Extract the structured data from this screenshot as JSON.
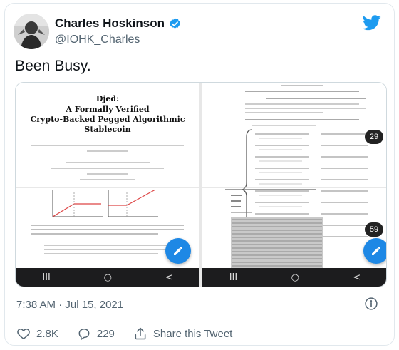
{
  "author": {
    "display_name": "Charles Hoskinson",
    "handle": "@IOHK_Charles"
  },
  "tweet": {
    "text": "Been Busy.",
    "timestamp": "7:38 AM · Jul 15, 2021"
  },
  "media": {
    "left_page": {
      "title_line1": "Djed:",
      "title_line2": "A Formally Verified",
      "title_line3": "Crypto-Backed Pegged Algorithmic",
      "title_line4": "Stablecoin"
    },
    "right_page": {
      "badge_top": "29",
      "badge_bottom": "59"
    },
    "navbar": {
      "recents": "III",
      "home": "○",
      "back": "<"
    }
  },
  "actions": {
    "likes": "2.8K",
    "replies": "229",
    "share_label": "Share this Tweet"
  },
  "colors": {
    "brand": "#1d9bf0",
    "fab": "#1e88e5",
    "muted": "#536471"
  },
  "icons": {
    "verified": "verified-badge-icon",
    "bird": "twitter-bird-icon",
    "info": "info-icon",
    "like": "heart-icon",
    "reply": "reply-bubble-icon",
    "share": "share-icon",
    "edit": "pencil-icon"
  }
}
